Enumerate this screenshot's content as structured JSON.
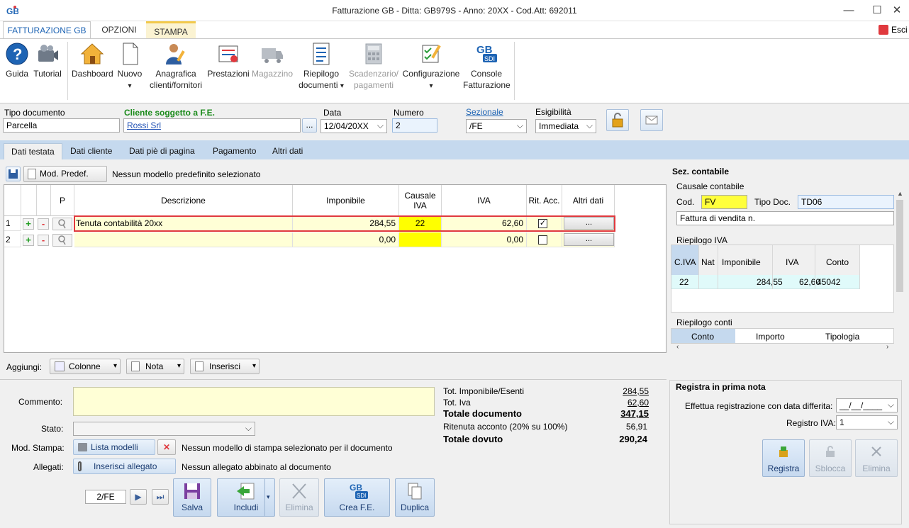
{
  "window": {
    "title": "Fatturazione GB - Ditta: GB979S - Anno: 20XX - Cod.Att: 692011",
    "minimize": "—",
    "maximize": "☐",
    "close": "✕",
    "esci": "Esci"
  },
  "ribbon_tabs": [
    "FATTURAZIONE GB",
    "OPZIONI",
    "STAMPA"
  ],
  "ribbon": {
    "guida": "Guida",
    "tutorial": "Tutorial",
    "dashboard": "Dashboard",
    "nuovo": "Nuovo",
    "anagrafica_1": "Anagrafica",
    "anagrafica_2": "clienti/fornitori",
    "prestazioni": "Prestazioni",
    "magazzino": "Magazzino",
    "riepilogo_1": "Riepilogo",
    "riepilogo_2": "documenti",
    "scadenzario_1": "Scadenzario/",
    "scadenzario_2": "pagamenti",
    "configurazione": "Configurazione",
    "console_1": "Console",
    "console_2": "Fatturazione",
    "dropdown_arrow": "▾"
  },
  "header": {
    "tipo_documento_label": "Tipo documento",
    "tipo_documento": "Parcella",
    "cliente_label": "Cliente soggetto a F.E.",
    "cliente": "Rossi Srl",
    "cliente_btn": "...",
    "data_label": "Data",
    "data": "12/04/20XX",
    "numero_label": "Numero",
    "numero": "2",
    "sezionale_label": "Sezionale",
    "sezionale": "/FE",
    "esigibilita_label": "Esigibilità",
    "esigibilita": "Immediata"
  },
  "tabs": [
    "Dati testata",
    "Dati cliente",
    "Dati piè di pagina",
    "Pagamento",
    "Altri dati"
  ],
  "model_bar": {
    "mod_predef": "Mod. Predef.",
    "status": "Nessun modello predefinito selezionato"
  },
  "grid": {
    "headers": {
      "p": "P",
      "descrizione": "Descrizione",
      "imponibile": "Imponibile",
      "causale_1": "Causale",
      "causale_2": "IVA",
      "iva": "IVA",
      "rit_acc": "Rit. Acc.",
      "altri_dati": "Altri dati"
    },
    "rows": [
      {
        "n": "1",
        "descrizione": "Tenuta contabilità 20xx",
        "imponibile": "284,55",
        "causale": "22",
        "iva": "62,60",
        "rit_acc": true,
        "altri": "..."
      },
      {
        "n": "2",
        "descrizione": "",
        "imponibile": "0,00",
        "causale": "",
        "iva": "0,00",
        "rit_acc": false,
        "altri": "..."
      }
    ],
    "plus": "+",
    "minus": "-",
    "check": "✓"
  },
  "sez_contabile": {
    "title": "Sez. contabile",
    "causale_label": "Causale contabile",
    "cod_label": "Cod.",
    "cod": "FV",
    "tipo_doc_label": "Tipo Doc.",
    "tipo_doc": "TD06",
    "descrizione": "Fattura di vendita n.",
    "riepilogo_iva_label": "Riepilogo IVA",
    "iva_headers": [
      "C.IVA",
      "Nat",
      "Imponibile",
      "IVA",
      "Conto"
    ],
    "iva_rows": [
      [
        "22",
        "",
        "284,55",
        "62,60",
        "45042"
      ]
    ],
    "riepilogo_conti_label": "Riepilogo conti",
    "conti_headers": [
      "Conto",
      "Importo",
      "Tipologia"
    ]
  },
  "aggiungi": {
    "label": "Aggiungi:",
    "colonne": "Colonne",
    "nota": "Nota",
    "inserisci": "Inserisci"
  },
  "bottom": {
    "commento_label": "Commento:",
    "stato_label": "Stato:",
    "mod_stampa_label": "Mod. Stampa:",
    "lista_modelli": "Lista modelli",
    "mod_stampa_status": "Nessun modello di stampa selezionato per il documento",
    "allegati_label": "Allegati:",
    "inserisci_allegato": "Inserisci allegato",
    "allegati_status": "Nessun allegato abbinato al documento",
    "nav_value": "2/FE",
    "salva": "Salva",
    "includi": "Includi",
    "elimina": "Elimina",
    "crea_fe": "Crea F.E.",
    "duplica": "Duplica"
  },
  "totals": {
    "tot_imponibile_label": "Tot. Imponibile/Esenti",
    "tot_imponibile": "284,55",
    "tot_iva_label": "Tot. Iva",
    "tot_iva": "62,60",
    "totale_documento_label": "Totale documento",
    "totale_documento": "347,15",
    "ritenuta_label": "Ritenuta acconto (20% su 100%)",
    "ritenuta": "56,91",
    "totale_dovuto_label": "Totale dovuto",
    "totale_dovuto": "290,24"
  },
  "prima_nota": {
    "title": "Registra in prima nota",
    "data_differita_label": "Effettua registrazione con data differita:",
    "data_differita": "__/__/____",
    "registro_iva_label": "Registro IVA:",
    "registro_iva": "1",
    "registra": "Registra",
    "sblocca": "Sblocca",
    "elimina": "Elimina"
  },
  "colors": {
    "accent": "#1e64b4",
    "highlight_row_border": "#e0393e",
    "yellow": "#ffff00",
    "row_bg": "#ffffd6",
    "tab_strip": "#c5d9ee"
  }
}
